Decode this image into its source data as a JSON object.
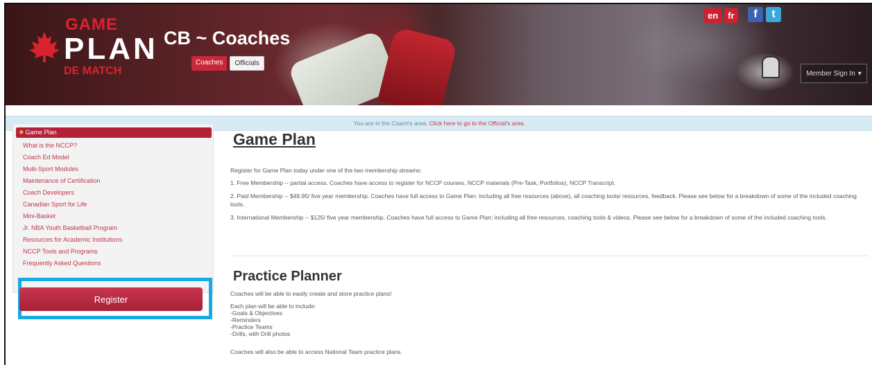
{
  "header": {
    "logo": {
      "line1": "GAME",
      "line2": "PLAN",
      "line3": "DE MATCH"
    },
    "site_title": "CB ~ Coaches",
    "tabs": [
      "Coaches",
      "Officials"
    ],
    "active_tab": "Coaches",
    "languages": [
      "en",
      "fr"
    ],
    "social": [
      "facebook-icon",
      "twitter-icon"
    ],
    "member_button": "Member Sign In"
  },
  "info_bar": {
    "prefix": "You are in the Coach's area. ",
    "link": "Click here to go to the Official's area."
  },
  "sidebar": {
    "active": "Game Plan",
    "items": [
      "What is the NCCP?",
      "Coach Ed Model",
      "Multi-Sport Modules",
      "Maintenance of Certification",
      "Coach Developers",
      "Canadian Sport for Life",
      "Mini-Basket",
      "Jr. NBA Youth Basketball Program",
      "Resources for Academic Institutions",
      "NCCP Tools and Programs",
      "Frequently Asked Questions"
    ],
    "register_label": "Register"
  },
  "main": {
    "title": "Game Plan",
    "intro": "Register for Game Plan today under one of the two membership streams:",
    "p1": "1. Free Membership -- partial access. Coaches have access to register for NCCP courses, NCCP materials (Pre-Task, Portfolios), NCCP Transcript.",
    "p2": "2. Paid Membership -- $49.95/ five year membership. Coaches have full access to Game Plan: including all free resources (above), all coaching tools/ resources, feedback. Please see below for a breakdown of some of the included coaching tools.",
    "p3": "3. International Membership -- $125/ five year membership. Coaches have full access to Game Plan: including all free resources, coaching tools & videos. Please see below for a breakdown of some of the included coaching tools.",
    "section2_title": "Practice Planner",
    "s2_p1": "Coaches will be able to easily create and store practice plans!",
    "s2_p2": "Each plan will be able to include:",
    "s2_list": [
      "-Goals & Objectives",
      "-Reminders",
      "-Practice Teams",
      "-Drills, with Drill photos"
    ],
    "s2_p3": "Coaches will also be able to access National Team practice plans."
  },
  "colors": {
    "accent": "#b4223a",
    "link": "#c2364c",
    "info_bg": "#d8eaf3",
    "highlight": "#18a9e6"
  }
}
